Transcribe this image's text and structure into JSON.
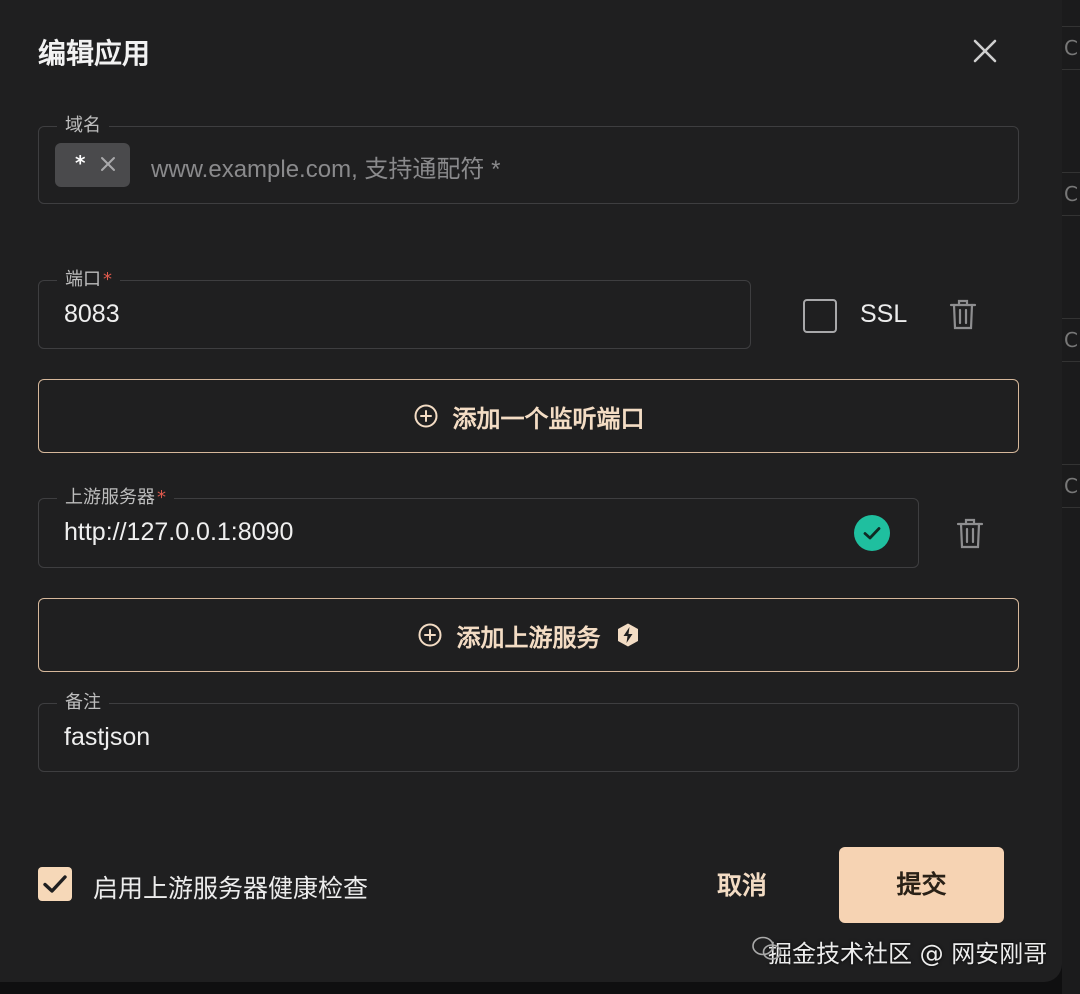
{
  "dialog": {
    "title": "编辑应用"
  },
  "domain": {
    "label": "域名",
    "chip": "*",
    "placeholder": "www.example.com, 支持通配符 *"
  },
  "port": {
    "label": "端口",
    "required_mark": "*",
    "value": "8083",
    "ssl_label": "SSL",
    "ssl_checked": false
  },
  "add_listen_port": {
    "label": "添加一个监听端口"
  },
  "upstream": {
    "label": "上游服务器",
    "required_mark": "*",
    "value": "http://127.0.0.1:8090",
    "status": "valid"
  },
  "add_upstream": {
    "label": "添加上游服务"
  },
  "remark": {
    "label": "备注",
    "value": "fastjson"
  },
  "health_check": {
    "label": "启用上游服务器健康检查",
    "checked": true
  },
  "buttons": {
    "cancel": "取消",
    "submit": "提交"
  },
  "watermark": {
    "text": "掘金技术社区 @ 网安刚哥"
  },
  "colors": {
    "accent": "#f6d3b3",
    "success": "#1fbf9f",
    "required": "#e05a4d"
  }
}
